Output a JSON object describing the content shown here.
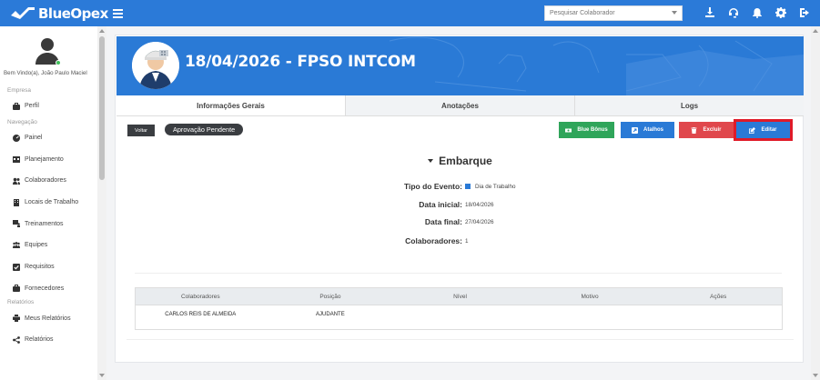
{
  "app": {
    "brand": "BlueOpex"
  },
  "topbar": {
    "search_placeholder": "Pesquisar Colaborador",
    "icons": [
      "download-icon",
      "headset-icon",
      "bell-icon",
      "gear-icon",
      "logout-icon"
    ]
  },
  "sidebar": {
    "welcome": "Bem Vindo(a), João Paulo Maciel",
    "sections": {
      "empresa": "Empresa",
      "navegacao": "Navegação",
      "relatorios": "Relatórios"
    },
    "items": {
      "perfil": "Perfil",
      "painel": "Painel",
      "planejamento": "Planejamento",
      "colaboradores": "Colaboradores",
      "locais": "Locais de Trabalho",
      "treinamentos": "Treinamentos",
      "equipes": "Equipes",
      "requisitos": "Requisitos",
      "fornecedores": "Fornecedores",
      "meus_relatorios": "Meus Relatórios",
      "relatorios": "Relatórios"
    }
  },
  "header": {
    "title": "18/04/2026 - FPSO INTCOM"
  },
  "tabs": [
    {
      "label": "Informações Gerais",
      "active": true
    },
    {
      "label": "Anotações",
      "active": false
    },
    {
      "label": "Logs",
      "active": false
    }
  ],
  "actions": {
    "voltar": "Voltar",
    "status": "Aprovação Pendente",
    "blue_bonus": "Blue Bônus",
    "atalhos": "Atalhos",
    "excluir": "Excluir",
    "editar": "Editar"
  },
  "section": {
    "title": "Embarque",
    "tipo_label": "Tipo do Evento:",
    "tipo_value": "Dia de Trabalho",
    "data_inicial_label": "Data inicial:",
    "data_inicial_value": "18/04/2026",
    "data_final_label": "Data final:",
    "data_final_value": "27/04/2026",
    "colaboradores_label": "Colaboradores:",
    "colaboradores_value": "1"
  },
  "table": {
    "headers": [
      "Colaboradores",
      "Posição",
      "Nível",
      "Motivo",
      "Ações"
    ],
    "rows": [
      [
        "CARLOS REIS DE ALMEIDA",
        "AJUDANTE",
        "",
        "",
        ""
      ]
    ]
  },
  "colors": {
    "primary": "#2a7ad6",
    "success": "#2fa55a",
    "danger": "#e0474c",
    "dark": "#3a3d41",
    "highlight": "#e01a28"
  }
}
